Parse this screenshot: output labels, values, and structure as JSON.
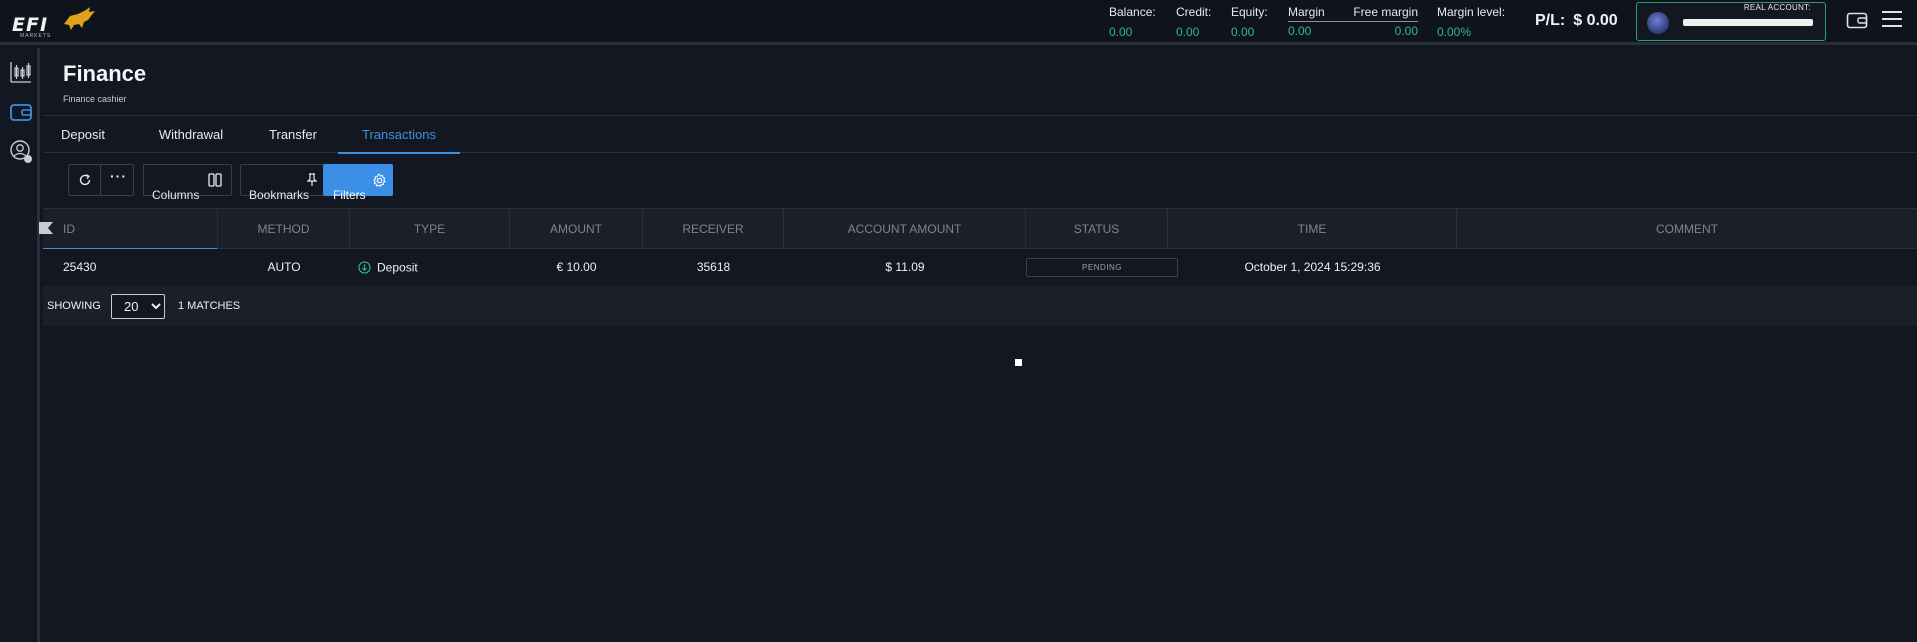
{
  "header": {
    "logo_text": "EFI",
    "logo_sub": "MARKETS",
    "stats": {
      "balance_label": "Balance:",
      "balance_value": "0.00",
      "credit_label": "Credit:",
      "credit_value": "0.00",
      "equity_label": "Equity:",
      "equity_value": "0.00",
      "margin_label": "Margin",
      "margin_value": "0.00",
      "free_margin_label": "Free margin",
      "free_margin_value": "0.00",
      "margin_level_label": "Margin level:",
      "margin_level_value": "0.00%"
    },
    "pl_label": "P/L:",
    "pl_value": "$ 0.00",
    "account_label": "REAL ACCOUNT:",
    "colors": {
      "accent_green": "#2fb59a",
      "accent_blue": "#3b8fe6"
    }
  },
  "sidebar": {
    "items": [
      {
        "icon": "candlestick-chart-icon"
      },
      {
        "icon": "wallet-icon",
        "active": true
      },
      {
        "icon": "user-support-icon"
      }
    ]
  },
  "page": {
    "title": "Finance",
    "subtitle": "Finance cashier"
  },
  "tabs": [
    {
      "label": "Deposit"
    },
    {
      "label": "Withdrawal"
    },
    {
      "label": "Transfer"
    },
    {
      "label": "Transactions",
      "active": true
    }
  ],
  "toolbar": {
    "columns_label": "Columns",
    "bookmarks_label": "Bookmarks",
    "filters_label": "Filters"
  },
  "table": {
    "columns": [
      "ID",
      "METHOD",
      "TYPE",
      "AMOUNT",
      "RECEIVER",
      "ACCOUNT AMOUNT",
      "STATUS",
      "TIME",
      "COMMENT"
    ],
    "rows": [
      {
        "id": "25430",
        "method": "AUTO",
        "type": "Deposit",
        "amount": "€ 10.00",
        "receiver": "35618",
        "account_amount": "$ 11.09",
        "status": "PENDING",
        "time": "October 1, 2024 15:29:36",
        "comment": ""
      }
    ]
  },
  "pager": {
    "showing_label": "SHOWING",
    "page_size": "20",
    "page_size_options": [
      "20"
    ],
    "matches_label": "1 MATCHES"
  }
}
